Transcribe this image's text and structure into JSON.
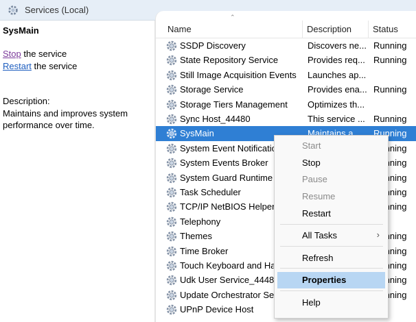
{
  "window": {
    "title": "Services (Local)"
  },
  "detail": {
    "service_name": "SysMain",
    "actions": [
      {
        "link": "Stop",
        "rest": " the service"
      },
      {
        "link": "Restart",
        "rest": " the service"
      }
    ],
    "description_label": "Description:",
    "description": "Maintains and improves system performance over time."
  },
  "columns": {
    "name": "Name",
    "description": "Description",
    "status": "Status"
  },
  "services": [
    {
      "name": "SSDP Discovery",
      "description": "Discovers ne...",
      "status": "Running"
    },
    {
      "name": "State Repository Service",
      "description": "Provides req...",
      "status": "Running"
    },
    {
      "name": "Still Image Acquisition Events",
      "description": "Launches ap...",
      "status": ""
    },
    {
      "name": "Storage Service",
      "description": "Provides ena...",
      "status": "Running"
    },
    {
      "name": "Storage Tiers Management",
      "description": "Optimizes th...",
      "status": ""
    },
    {
      "name": "Sync Host_44480",
      "description": "This service ...",
      "status": "Running"
    },
    {
      "name": "SysMain",
      "description": "Maintains a...",
      "status": "Running"
    },
    {
      "name": "System Event Notification",
      "description": "",
      "status": "Running"
    },
    {
      "name": "System Events Broker",
      "description": "",
      "status": "Running"
    },
    {
      "name": "System Guard Runtime",
      "description": "",
      "status": "Running"
    },
    {
      "name": "Task Scheduler",
      "description": "",
      "status": "Running"
    },
    {
      "name": "TCP/IP NetBIOS Helper",
      "description": "",
      "status": "Running"
    },
    {
      "name": "Telephony",
      "description": "",
      "status": ""
    },
    {
      "name": "Themes",
      "description": "",
      "status": "Running"
    },
    {
      "name": "Time Broker",
      "description": "",
      "status": "Running"
    },
    {
      "name": "Touch Keyboard and Handwriting",
      "description": "",
      "status": "Running"
    },
    {
      "name": "Udk User Service_44480",
      "description": "",
      "status": "Running"
    },
    {
      "name": "Update Orchestrator Service",
      "description": "",
      "status": "Running"
    },
    {
      "name": "UPnP Device Host",
      "description": "",
      "status": ""
    }
  ],
  "context_menu": {
    "start": "Start",
    "stop": "Stop",
    "pause": "Pause",
    "resume": "Resume",
    "restart": "Restart",
    "all_tasks": "All Tasks",
    "refresh": "Refresh",
    "properties": "Properties",
    "help": "Help"
  },
  "colors": {
    "selection": "#2f7fd4",
    "menu_highlight": "#b8d6f3",
    "link": "#1d5dbf"
  }
}
